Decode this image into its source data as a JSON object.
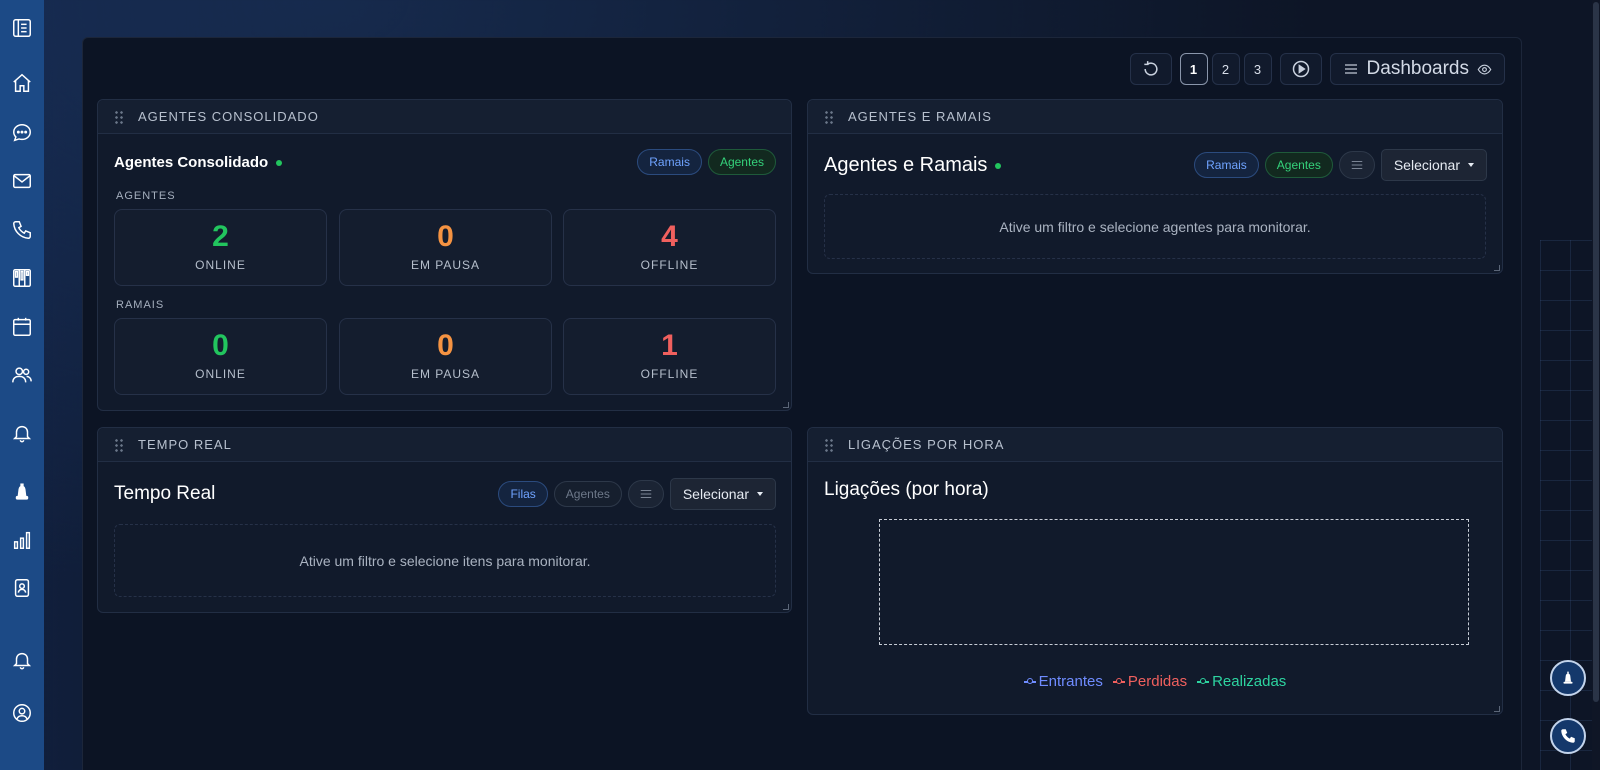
{
  "toolbar": {
    "pages": [
      "1",
      "2",
      "3"
    ],
    "dashboards_label": "Dashboards"
  },
  "widget_agentes_consolidado": {
    "header": "AGENTES CONSOLIDADO",
    "title": "Agentes Consolidado",
    "pill_ramais": "Ramais",
    "pill_agentes": "Agentes",
    "section_agentes": "AGENTES",
    "section_ramais": "RAMAIS",
    "agentes": [
      {
        "value": "2",
        "label": "ONLINE"
      },
      {
        "value": "0",
        "label": "EM PAUSA"
      },
      {
        "value": "4",
        "label": "OFFLINE"
      }
    ],
    "ramais": [
      {
        "value": "0",
        "label": "ONLINE"
      },
      {
        "value": "0",
        "label": "EM PAUSA"
      },
      {
        "value": "1",
        "label": "OFFLINE"
      }
    ]
  },
  "widget_agentes_ramais": {
    "header": "AGENTES E RAMAIS",
    "title": "Agentes e Ramais",
    "pill_ramais": "Ramais",
    "pill_agentes": "Agentes",
    "select_label": "Selecionar",
    "empty_message": "Ative um filtro e selecione agentes para monitorar."
  },
  "widget_tempo_real": {
    "header": "TEMPO REAL",
    "title": "Tempo Real",
    "pill_filas": "Filas",
    "pill_agentes": "Agentes",
    "select_label": "Selecionar",
    "empty_message": "Ative um filtro e selecione itens para monitorar."
  },
  "widget_ligacoes": {
    "header": "LIGAÇÕES POR HORA",
    "title": "Ligações (por hora)"
  },
  "chart_data": {
    "type": "line",
    "title": "Ligações (por hora)",
    "legend_position": "bottom",
    "series": [
      {
        "name": "Entrantes",
        "color": "#6f8cff",
        "values": []
      },
      {
        "name": "Perdidas",
        "color": "#f0605e",
        "values": []
      },
      {
        "name": "Realizadas",
        "color": "#2dd4a0",
        "values": []
      }
    ]
  },
  "colors": {
    "sidebar": "#1c4a86",
    "online": "#22c55e",
    "pause": "#f59342",
    "offline": "#f0605e"
  },
  "sidebar_icons": [
    "menu-book-icon",
    "home-icon",
    "chat-icon",
    "mail-icon",
    "phone-icon",
    "kanban-icon",
    "calendar-icon",
    "users-icon",
    "bell-icon",
    "bell-solid-icon",
    "bar-chart-icon",
    "contact-card-icon",
    "notifications-icon",
    "user-circle-icon"
  ]
}
